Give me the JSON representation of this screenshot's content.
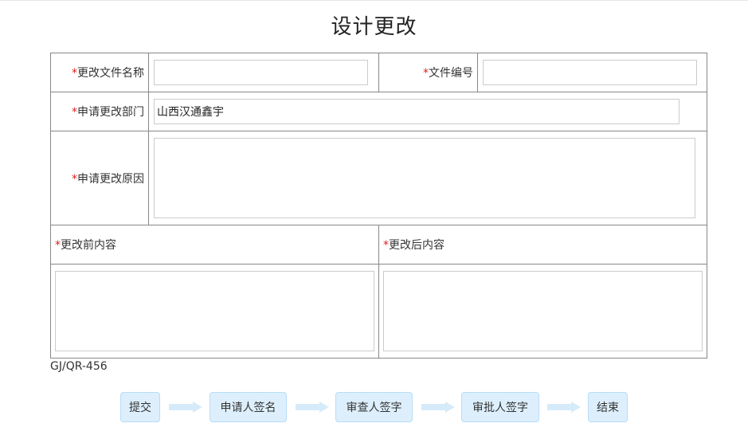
{
  "form": {
    "title": "设计更改",
    "required_mark": "*",
    "fields": {
      "file_name": {
        "label": "更改文件名称",
        "value": ""
      },
      "file_number": {
        "label": "文件编号",
        "value": ""
      },
      "department": {
        "label": "申请更改部门",
        "value": "山西汉通鑫宇"
      },
      "reason": {
        "label": "申请更改原因",
        "value": ""
      },
      "before_content": {
        "label": "更改前内容",
        "value": ""
      },
      "after_content": {
        "label": "更改后内容",
        "value": ""
      }
    },
    "form_code": "GJ/QR-456"
  },
  "workflow": {
    "steps": [
      {
        "label": "提交"
      },
      {
        "label": "申请人签名"
      },
      {
        "label": "审查人签字"
      },
      {
        "label": "审批人签字"
      },
      {
        "label": "结束"
      }
    ]
  },
  "colors": {
    "required": "#e02020",
    "step_background": "#ddeffc",
    "step_border": "#b8dcf7",
    "arrow": "#d6ebfa",
    "table_border": "#888888"
  }
}
